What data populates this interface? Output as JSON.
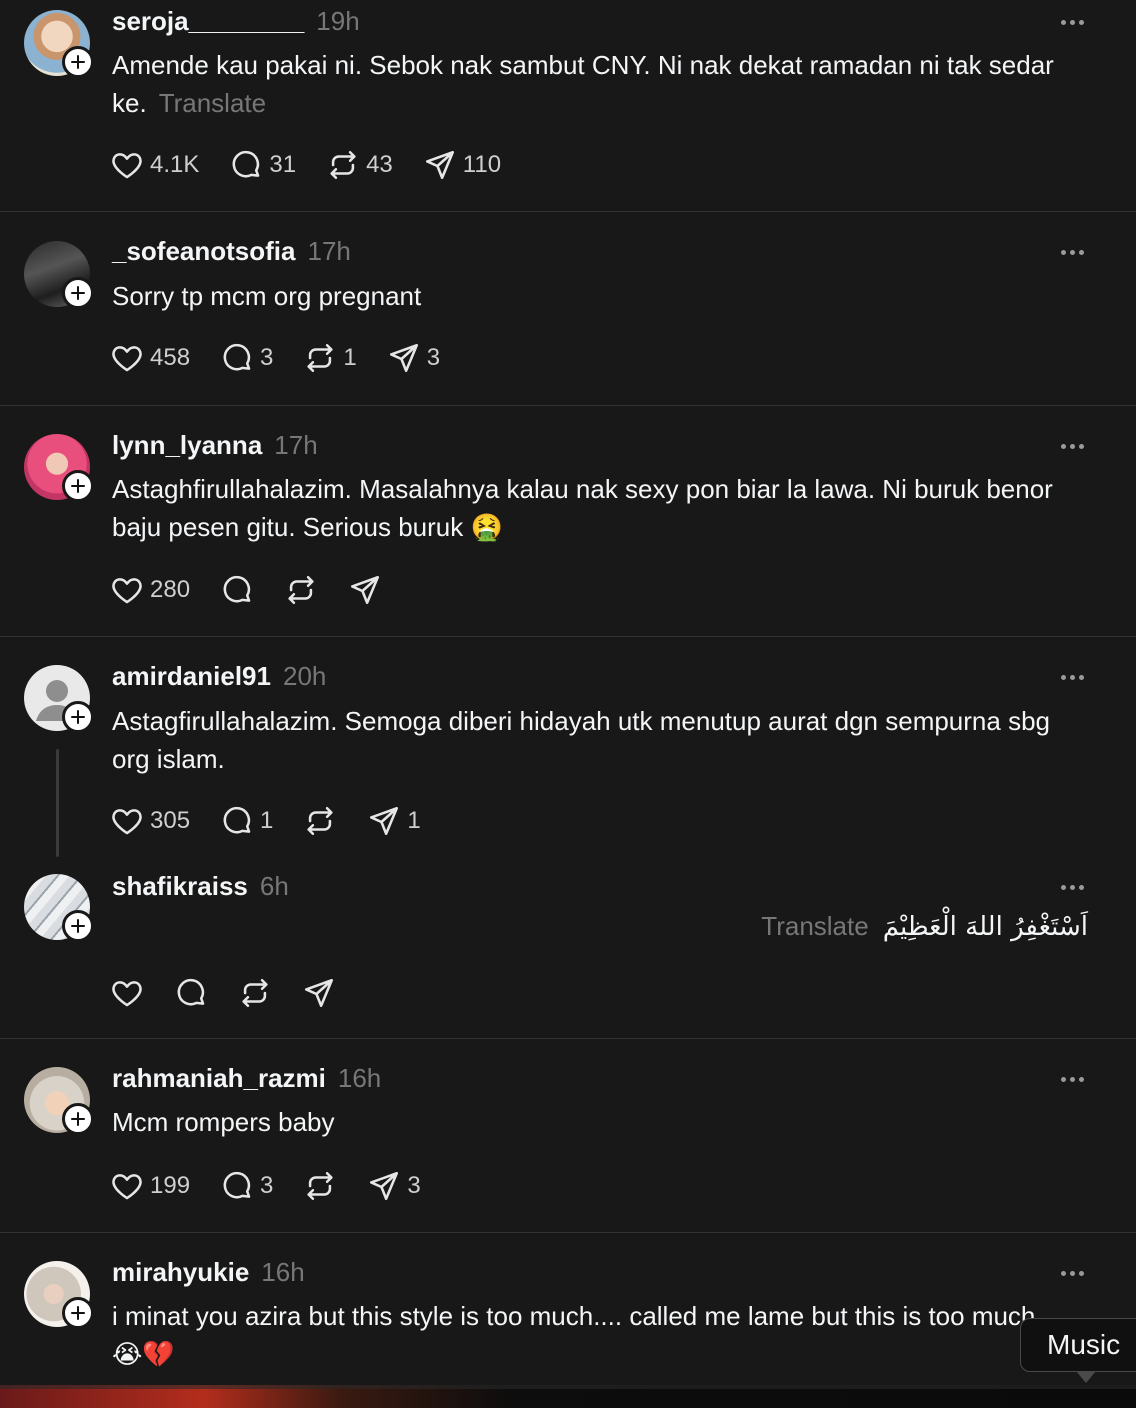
{
  "posts": [
    {
      "username": "seroja________",
      "time": "19h",
      "text": "Amende kau pakai ni. Sebok nak sambut CNY. Ni nak dekat ramadan ni tak sedar ke.",
      "translate": "Translate",
      "likes": "4.1K",
      "replies": "31",
      "reposts": "43",
      "shares": "110"
    },
    {
      "username": "_sofeanotsofia",
      "time": "17h",
      "text": "Sorry tp mcm org pregnant",
      "likes": "458",
      "replies": "3",
      "reposts": "1",
      "shares": "3"
    },
    {
      "username": "lynn_lyanna",
      "time": "17h",
      "text": "Astaghfirullahalazim. Masalahnya kalau nak sexy pon biar la lawa. Ni buruk benor baju pesen gitu. Serious buruk 🤮",
      "likes": "280",
      "replies": "",
      "reposts": "",
      "shares": ""
    },
    {
      "username": "amirdaniel91",
      "time": "20h",
      "text": "Astagfirullahalazim. Semoga diberi hidayah utk menutup aurat dgn sempurna sbg org islam.",
      "likes": "305",
      "replies": "1",
      "reposts": "",
      "shares": "1"
    },
    {
      "username": "shafikraiss",
      "time": "6h",
      "text": "اَسْتَغْفِرُ اللهَ الْعَظِيْمَ",
      "translate": "Translate",
      "likes": "",
      "replies": "",
      "reposts": "",
      "shares": ""
    },
    {
      "username": "rahmaniah_razmi",
      "time": "16h",
      "text": "Mcm rompers baby",
      "likes": "199",
      "replies": "3",
      "reposts": "",
      "shares": "3"
    },
    {
      "username": "mirahyukie",
      "time": "16h",
      "text": "i minat you azira but this style is too much.... called me lame but this is too much 😭💔"
    }
  ],
  "tooltip": {
    "label": "Music"
  },
  "icons": {
    "like": "heart-icon",
    "reply": "comment-icon",
    "repost": "repost-icon",
    "share": "send-icon",
    "more": "more-dots-icon",
    "follow": "plus-icon"
  },
  "colors": {
    "background": "#181818",
    "text": "#f3f5f7",
    "muted": "#777777",
    "divider": "#333333"
  }
}
